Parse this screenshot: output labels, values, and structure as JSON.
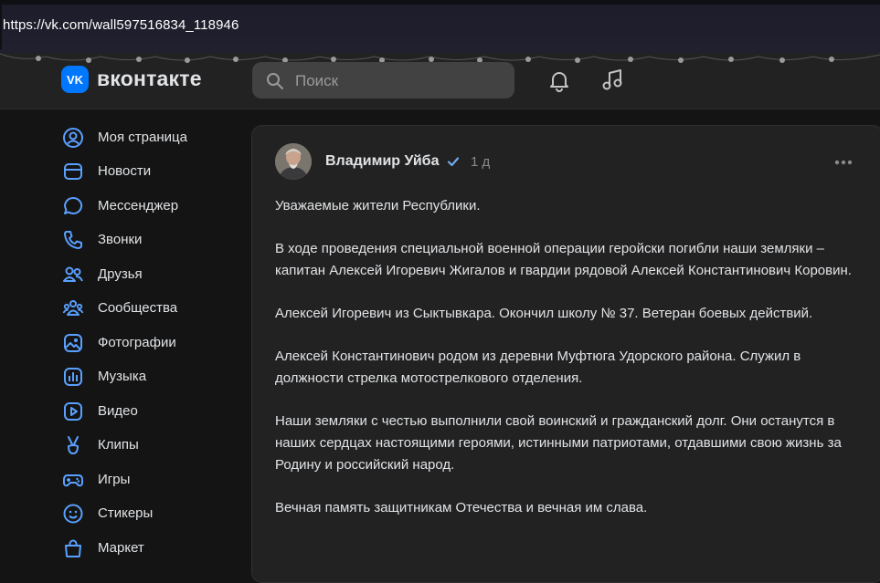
{
  "browser": {
    "url": "https://vk.com/wall597516834_118946"
  },
  "header": {
    "logo_text": "вконтакте",
    "search_placeholder": "Поиск",
    "accent": "#0077ff"
  },
  "sidebar": {
    "items": [
      {
        "label": "Моя страница",
        "icon": "user-circle-icon"
      },
      {
        "label": "Новости",
        "icon": "news-icon"
      },
      {
        "label": "Мессенджер",
        "icon": "message-icon"
      },
      {
        "label": "Звонки",
        "icon": "phone-icon"
      },
      {
        "label": "Друзья",
        "icon": "friends-icon"
      },
      {
        "label": "Сообщества",
        "icon": "communities-icon"
      },
      {
        "label": "Фотографии",
        "icon": "photos-icon"
      },
      {
        "label": "Музыка",
        "icon": "music-bars-icon"
      },
      {
        "label": "Видео",
        "icon": "video-icon"
      },
      {
        "label": "Клипы",
        "icon": "clips-icon"
      },
      {
        "label": "Игры",
        "icon": "gamepad-icon"
      },
      {
        "label": "Стикеры",
        "icon": "smile-icon"
      },
      {
        "label": "Маркет",
        "icon": "bag-icon"
      }
    ]
  },
  "post": {
    "author": "Владимир Уйба",
    "time": "1 д",
    "paragraphs": [
      "Уважаемые жители Республики.",
      "В ходе проведения специальной военной операции геройски погибли наши земляки – капитан Алексей Игоревич Жигалов и гвардии рядовой Алексей Константинович Коровин.",
      "Алексей Игоревич из Сыктывкара. Окончил школу № 37. Ветеран боевых действий.",
      "Алексей Константинович родом из деревни Муфтюга Удорского района. Служил в должности стрелка мотострелкового отделения.",
      "Наши земляки с честью выполнили свой воинский и гражданский долг. Они останутся в наших сердцах настоящими героями, истинными патриотами, отдавшими свою жизнь за Родину и российский народ.",
      "Вечная память защитникам Отечества и вечная им слава."
    ]
  }
}
